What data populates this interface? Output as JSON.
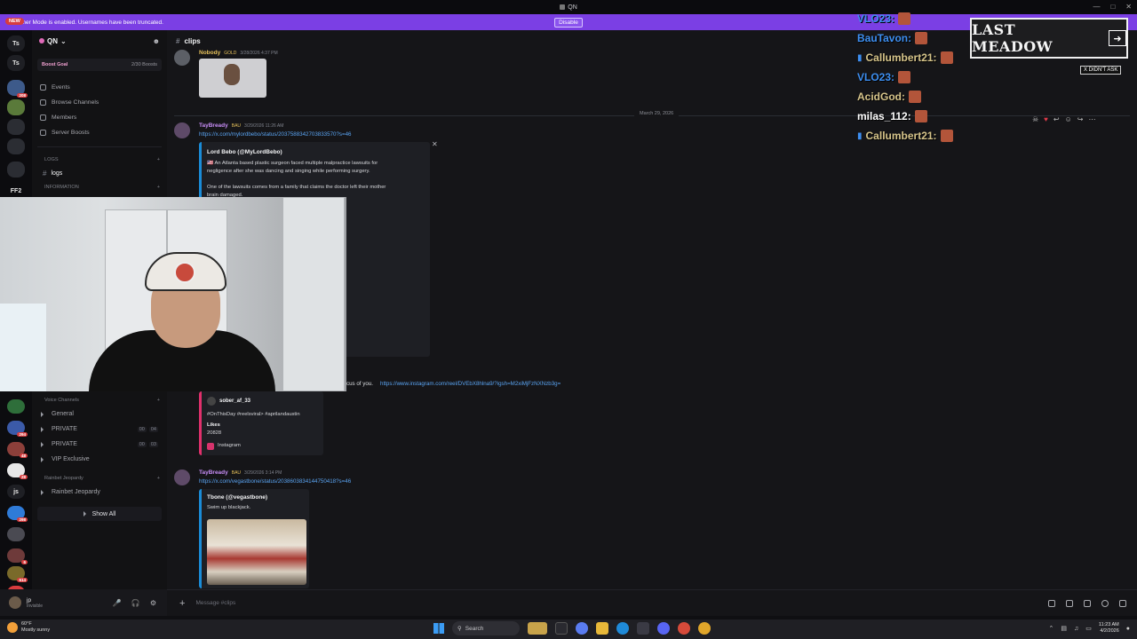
{
  "window": {
    "title": "QN"
  },
  "banner": {
    "message": "Streamer Mode is enabled. Usernames have been truncated.",
    "disable_label": "Disable"
  },
  "new_badge": "NEW",
  "rail": {
    "items": [
      {
        "label": "Ts",
        "color": "#1e1f24"
      },
      {
        "label": "Ts",
        "color": "#1e1f24"
      },
      {
        "label": "",
        "color": "#3d5a8a",
        "count": "208"
      },
      {
        "label": "",
        "color": "#5a7a3a"
      },
      {
        "label": "",
        "color": "#2b2d33"
      },
      {
        "label": "",
        "color": "#2b2d33"
      },
      {
        "label": "",
        "color": "#2b2d33"
      },
      {
        "label": "FF2",
        "color": "#0c0c0f"
      }
    ],
    "lower_items": [
      {
        "label": "",
        "color": "#2e6e3a"
      },
      {
        "label": "",
        "color": "#3b5aa8",
        "count": "294"
      },
      {
        "label": "",
        "color": "#8c3f3a",
        "count": "48"
      },
      {
        "label": "",
        "color": "#e7e7e7",
        "count": "28"
      },
      {
        "label": "js",
        "color": "#1e1f24"
      },
      {
        "label": "",
        "color": "#2f7bd8",
        "count": "298"
      },
      {
        "label": "",
        "color": "#4a4a52"
      },
      {
        "label": "",
        "color": "#6e3a3a",
        "count": "6"
      },
      {
        "label": "",
        "color": "#7a6a2a",
        "count": "614"
      },
      {
        "label": "NEW",
        "color": "#d83c3e",
        "count": "149"
      }
    ]
  },
  "sidebar": {
    "server_name": "QN",
    "boost_goal": "Boost Goal",
    "boost_count": "2/30 Boosts",
    "nav": [
      {
        "label": "Events"
      },
      {
        "label": "Browse Channels"
      },
      {
        "label": "Members"
      },
      {
        "label": "Server Boosts"
      }
    ],
    "cat_logs": "LOGS",
    "chan_logs": "logs",
    "cat_information": "INFORMATION",
    "voice_category": "Voice Channels",
    "voice": [
      {
        "label": "General",
        "a": "",
        "b": ""
      },
      {
        "label": "PRIVATE",
        "a": "00",
        "b": "04"
      },
      {
        "label": "PRIVATE",
        "a": "00",
        "b": "03"
      },
      {
        "label": "VIP Exclusive",
        "a": "",
        "b": ""
      }
    ],
    "cat_rainbet": "Rainbet Jeopardy",
    "chan_rainbet": "Rainbet Jeopardy",
    "show_all": "Show All"
  },
  "user": {
    "name": "jp",
    "status": "Invisible"
  },
  "chat": {
    "channel": "clips",
    "top_author": "Nobody",
    "top_role": "GOLD",
    "top_time": "3/28/2026 4:37 PM",
    "date_divider": "March 29, 2026",
    "msg1": {
      "author": "TayBready",
      "role": "BAU",
      "time": "3/29/2026 11:26 AM",
      "link": "https://x.com/mylordbebo/status/2037588342703833570?s=46",
      "embed_title": "Lord Bebo (@MyLordBebo)",
      "embed_line1": "🇺🇸 An Atlanta based plastic surgeon faced multiple malpractice lawsuits for",
      "embed_line2": "negligence after she was dancing and singing while performing surgery.",
      "embed_line3": "One of the lawsuits comes from a family that claims the doctor left their mother",
      "embed_line4": "brain damaged."
    },
    "msg2": {
      "text": "cus of you.",
      "link": "https://www.instagram.com/reel/DVEbX8hlna9/?igsh=M2xiMjFzNXNzb3g=",
      "ig_user": "sober_af_33",
      "ig_line": "#OnThisDay #reelsviral> #aprilandaustin",
      "likes_label": "Likes",
      "likes": "20828",
      "ig_footer": "Instagram"
    },
    "msg3": {
      "author": "TayBready",
      "role": "BAU",
      "time": "3/29/2026 3:14 PM",
      "link": "https://x.com/vegastbone/status/2038603834144750418?s=46",
      "embed_title": "Tbone (@vegastbone)",
      "embed_text": "Swim up blackjack."
    },
    "composer_placeholder": "Message #clips"
  },
  "overlay_chat": [
    {
      "name": "VLO23:",
      "style": "blue",
      "badge": false
    },
    {
      "name": "BauTavon:",
      "style": "blue",
      "badge": false
    },
    {
      "name": "Callumbert21:",
      "style": "gold",
      "badge": true
    },
    {
      "name": "VLO23:",
      "style": "blue",
      "badge": false
    },
    {
      "name": "AcidGod:",
      "style": "gold",
      "badge": false
    },
    {
      "name": "milas_112:",
      "style": "white",
      "badge": false
    },
    {
      "name": "Callumbert21:",
      "style": "gold",
      "badge": true
    }
  ],
  "last_meadow": {
    "title": "LAST MEADOW",
    "dont_ask": "X DIDN'T ASK"
  },
  "taskbar": {
    "weather_temp": "60°F",
    "weather_desc": "Mostly sunny",
    "search_label": "Search",
    "time": "11:23 AM",
    "date": "4/2/2026"
  }
}
